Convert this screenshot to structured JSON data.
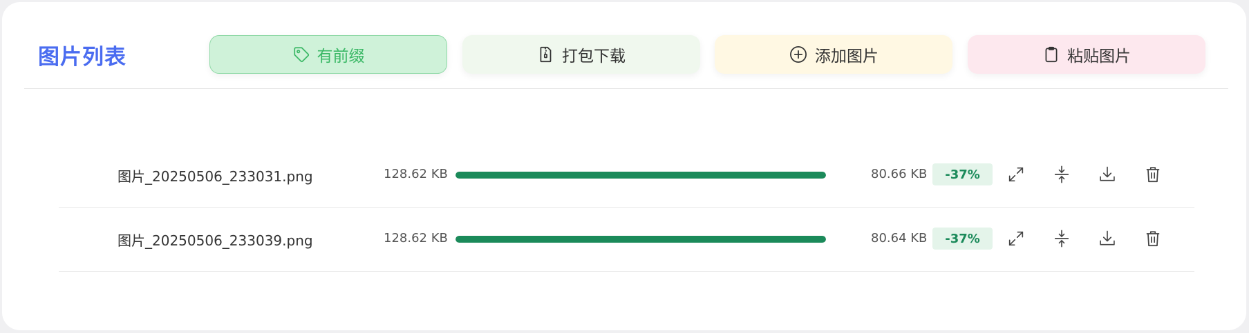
{
  "header": {
    "title": "图片列表",
    "buttons": {
      "prefix": {
        "label": "有前缀",
        "icon": "tag-icon",
        "color": "#3bb866"
      },
      "zip": {
        "label": "打包下载",
        "icon": "zip-file-icon"
      },
      "add": {
        "label": "添加图片",
        "icon": "plus-circle-icon"
      },
      "paste": {
        "label": "粘贴图片",
        "icon": "clipboard-icon"
      }
    }
  },
  "colors": {
    "accent": "#4a6cf0",
    "progress": "#1b8a5a",
    "badge_bg": "#e4f4ea"
  },
  "files": [
    {
      "name": "图片_20250506_233031.png",
      "original_size": "128.62 KB",
      "progress": 1.0,
      "compressed_size": "80.66 KB",
      "reduction": "-37%"
    },
    {
      "name": "图片_20250506_233039.png",
      "original_size": "128.62 KB",
      "progress": 1.0,
      "compressed_size": "80.64 KB",
      "reduction": "-37%"
    }
  ],
  "row_actions": [
    "expand-icon",
    "compress-icon",
    "download-icon",
    "trash-icon"
  ]
}
